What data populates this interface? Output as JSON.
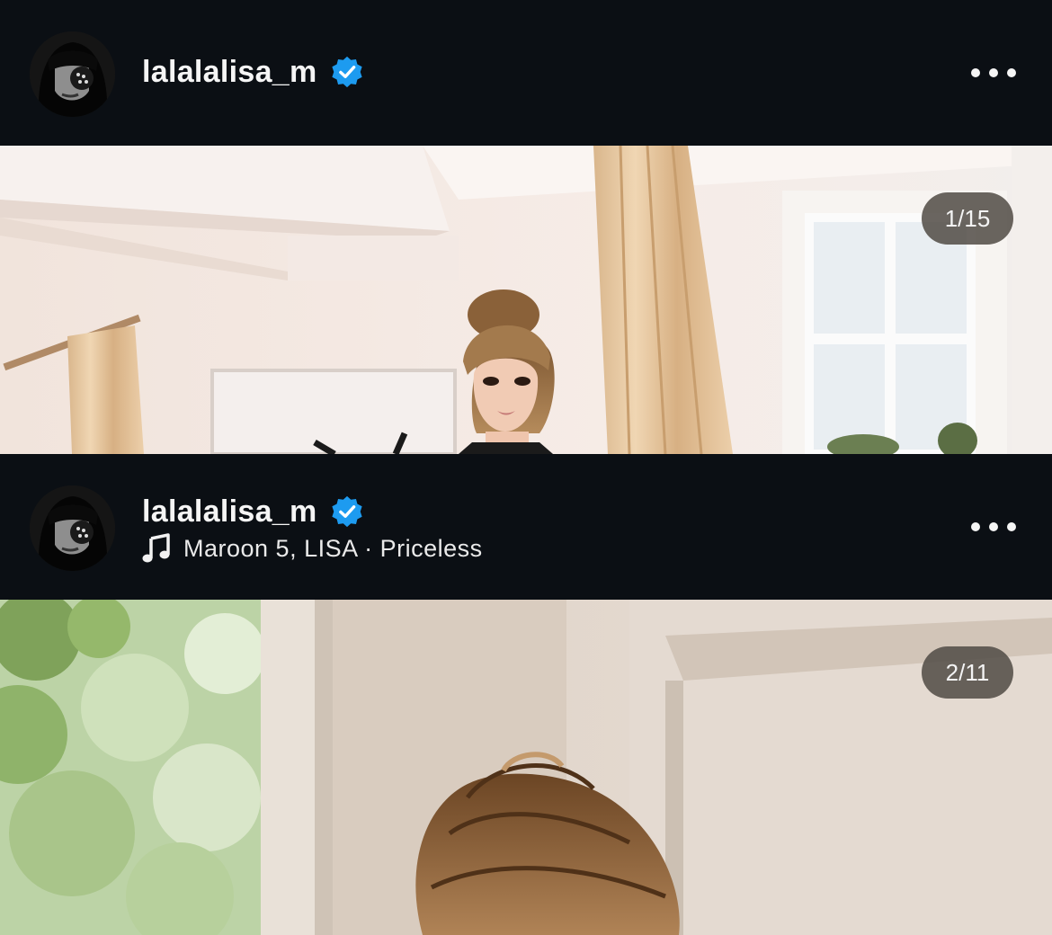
{
  "posts": [
    {
      "username": "lalalalisa_m",
      "verified": true,
      "music": null,
      "slide_counter": "1/15"
    },
    {
      "username": "lalalalisa_m",
      "verified": true,
      "music": "Maroon 5, LISA · Priceless",
      "slide_counter": "2/11"
    }
  ],
  "icons": {
    "verified": "verified-badge-icon",
    "more": "more-options-icon",
    "music": "music-note-icon"
  },
  "colors": {
    "background": "#0b0f14",
    "verified_blue": "#1d9bf0",
    "counter_bg": "#504a44"
  }
}
